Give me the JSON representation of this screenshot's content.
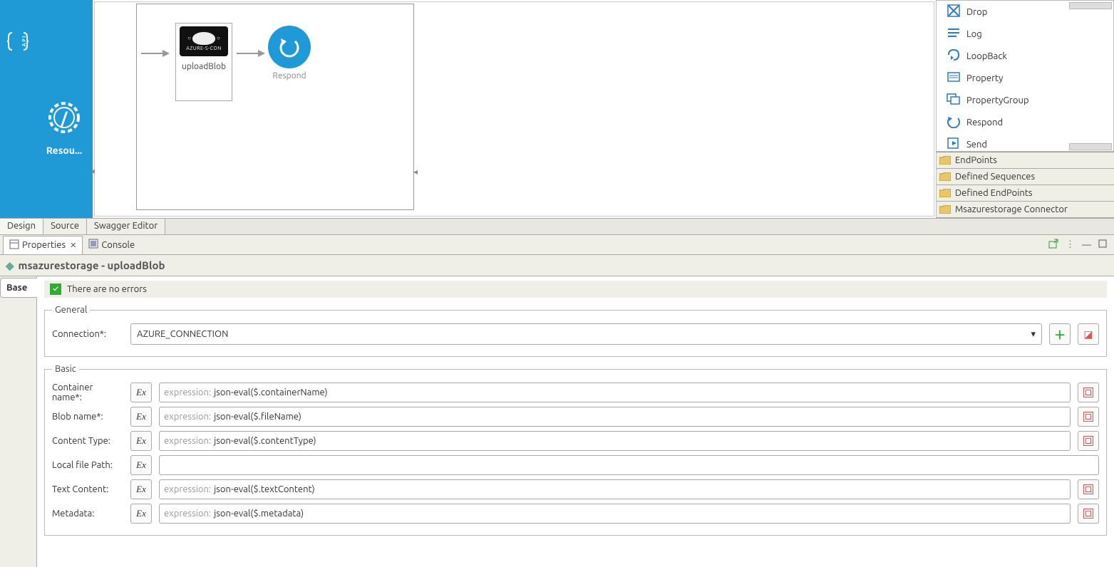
{
  "canvas": {
    "node1_caption": "uploadBlob",
    "node1_badge": "AZURE-S-CON",
    "respond_caption": "Respond"
  },
  "sidebar": {
    "resou_label": "Resou..."
  },
  "palette": {
    "items": [
      {
        "label": "Drop"
      },
      {
        "label": "Log"
      },
      {
        "label": "LoopBack"
      },
      {
        "label": "Property"
      },
      {
        "label": "PropertyGroup"
      },
      {
        "label": "Respond"
      },
      {
        "label": "Send"
      }
    ],
    "folders": [
      {
        "label": "EndPoints"
      },
      {
        "label": "Defined Sequences"
      },
      {
        "label": "Defined EndPoints"
      },
      {
        "label": "Msazurestorage Connector"
      }
    ]
  },
  "editor_tabs": {
    "t0": "Design",
    "t1": "Source",
    "t2": "Swagger Editor"
  },
  "panel_tabs": {
    "t0": "Properties",
    "t1": "Console"
  },
  "prop_heading": "msazurestorage -  uploadBlob",
  "base_tab": "Base",
  "no_errors": "There are no errors",
  "sections": {
    "general": "General",
    "basic": "Basic"
  },
  "general": {
    "connection_label": "Connection*:",
    "connection_value": "AZURE_CONNECTION"
  },
  "basic": {
    "rows": [
      {
        "label": "Container name*:",
        "prefix": "expression:",
        "value": "json-eval($.containerName)",
        "end": true
      },
      {
        "label": "Blob name*:",
        "prefix": "expression:",
        "value": "json-eval($.fileName)",
        "end": true
      },
      {
        "label": "Content Type:",
        "prefix": "expression:",
        "value": "json-eval($.contentType)",
        "end": true
      },
      {
        "label": "Local file Path:",
        "prefix": "",
        "value": "",
        "end": false
      },
      {
        "label": "Text Content:",
        "prefix": "expression:",
        "value": "json-eval($.textContent)",
        "end": true
      },
      {
        "label": "Metadata:",
        "prefix": "expression:",
        "value": "json-eval($.metadata)",
        "end": true
      }
    ]
  }
}
